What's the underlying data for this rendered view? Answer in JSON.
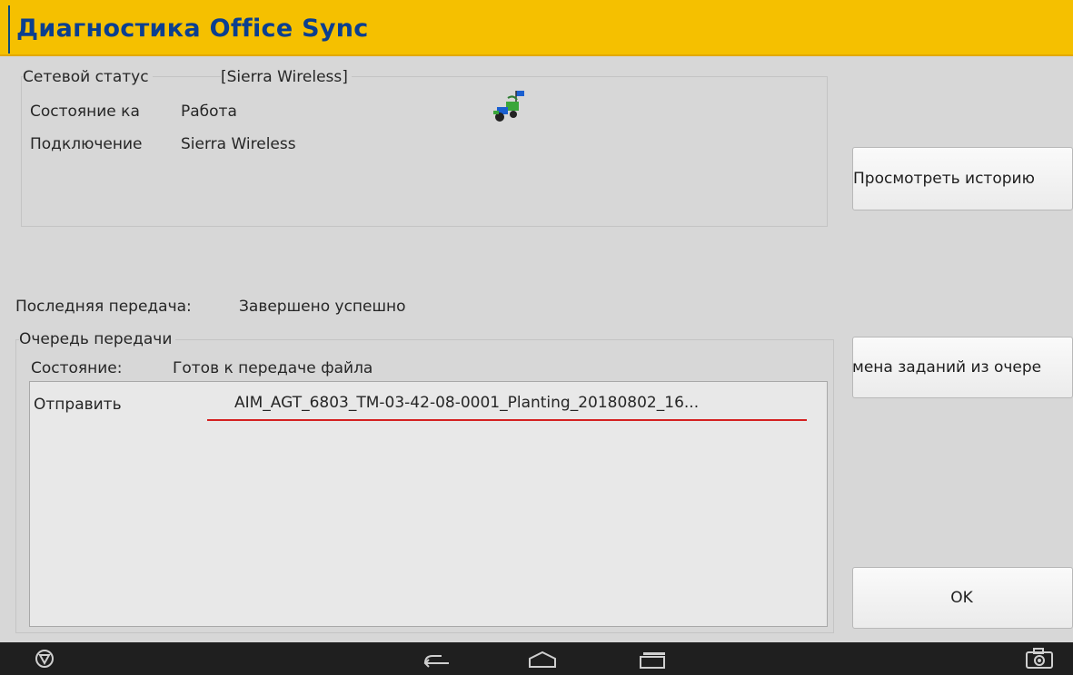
{
  "window": {
    "title": "Диагностика Office Sync"
  },
  "network": {
    "legend": "Сетевой статус",
    "legend_value": "[Sierra Wireless]",
    "state_label": "Состояние ка",
    "state_value": "Работа",
    "connection_label": "Подключение",
    "connection_value": "Sierra Wireless",
    "status_icon": "network-connected-icon"
  },
  "last_transfer": {
    "label": "Последняя передача:",
    "value": "Завершено успешно"
  },
  "queue": {
    "legend": "Очередь передачи",
    "state_label": "Состояние:",
    "state_value": "Готов к передаче файла",
    "items": [
      {
        "action": "Отправить",
        "file": "AIM_AGT_6803_TM-03-42-08-0001_Planting_20180802_16..."
      }
    ]
  },
  "buttons": {
    "history": "Просмотреть историю",
    "remove_jobs": "мена заданий из очере",
    "ok": "OK"
  },
  "navbar": {
    "icons": [
      "logo-icon",
      "back-icon",
      "home-icon",
      "recent-apps-icon",
      "screenshot-icon"
    ]
  },
  "colors": {
    "title_bar": "#f5c000",
    "title_text": "#0b3f8f",
    "underline": "#d42020"
  }
}
